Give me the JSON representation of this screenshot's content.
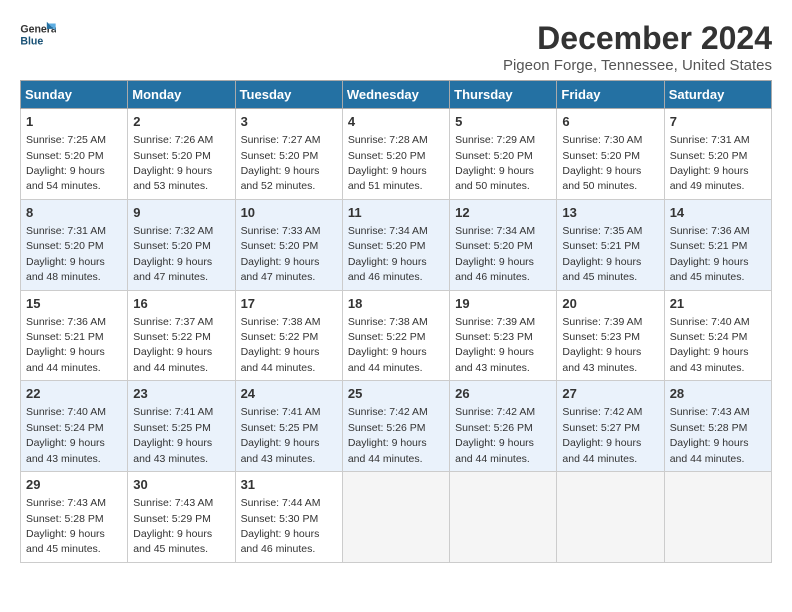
{
  "header": {
    "logo_general": "General",
    "logo_blue": "Blue",
    "month_title": "December 2024",
    "location": "Pigeon Forge, Tennessee, United States"
  },
  "weekdays": [
    "Sunday",
    "Monday",
    "Tuesday",
    "Wednesday",
    "Thursday",
    "Friday",
    "Saturday"
  ],
  "weeks": [
    [
      {
        "day": "1",
        "sunrise": "7:25 AM",
        "sunset": "5:20 PM",
        "daylight": "9 hours and 54 minutes."
      },
      {
        "day": "2",
        "sunrise": "7:26 AM",
        "sunset": "5:20 PM",
        "daylight": "9 hours and 53 minutes."
      },
      {
        "day": "3",
        "sunrise": "7:27 AM",
        "sunset": "5:20 PM",
        "daylight": "9 hours and 52 minutes."
      },
      {
        "day": "4",
        "sunrise": "7:28 AM",
        "sunset": "5:20 PM",
        "daylight": "9 hours and 51 minutes."
      },
      {
        "day": "5",
        "sunrise": "7:29 AM",
        "sunset": "5:20 PM",
        "daylight": "9 hours and 50 minutes."
      },
      {
        "day": "6",
        "sunrise": "7:30 AM",
        "sunset": "5:20 PM",
        "daylight": "9 hours and 50 minutes."
      },
      {
        "day": "7",
        "sunrise": "7:31 AM",
        "sunset": "5:20 PM",
        "daylight": "9 hours and 49 minutes."
      }
    ],
    [
      {
        "day": "8",
        "sunrise": "7:31 AM",
        "sunset": "5:20 PM",
        "daylight": "9 hours and 48 minutes."
      },
      {
        "day": "9",
        "sunrise": "7:32 AM",
        "sunset": "5:20 PM",
        "daylight": "9 hours and 47 minutes."
      },
      {
        "day": "10",
        "sunrise": "7:33 AM",
        "sunset": "5:20 PM",
        "daylight": "9 hours and 47 minutes."
      },
      {
        "day": "11",
        "sunrise": "7:34 AM",
        "sunset": "5:20 PM",
        "daylight": "9 hours and 46 minutes."
      },
      {
        "day": "12",
        "sunrise": "7:34 AM",
        "sunset": "5:20 PM",
        "daylight": "9 hours and 46 minutes."
      },
      {
        "day": "13",
        "sunrise": "7:35 AM",
        "sunset": "5:21 PM",
        "daylight": "9 hours and 45 minutes."
      },
      {
        "day": "14",
        "sunrise": "7:36 AM",
        "sunset": "5:21 PM",
        "daylight": "9 hours and 45 minutes."
      }
    ],
    [
      {
        "day": "15",
        "sunrise": "7:36 AM",
        "sunset": "5:21 PM",
        "daylight": "9 hours and 44 minutes."
      },
      {
        "day": "16",
        "sunrise": "7:37 AM",
        "sunset": "5:22 PM",
        "daylight": "9 hours and 44 minutes."
      },
      {
        "day": "17",
        "sunrise": "7:38 AM",
        "sunset": "5:22 PM",
        "daylight": "9 hours and 44 minutes."
      },
      {
        "day": "18",
        "sunrise": "7:38 AM",
        "sunset": "5:22 PM",
        "daylight": "9 hours and 44 minutes."
      },
      {
        "day": "19",
        "sunrise": "7:39 AM",
        "sunset": "5:23 PM",
        "daylight": "9 hours and 43 minutes."
      },
      {
        "day": "20",
        "sunrise": "7:39 AM",
        "sunset": "5:23 PM",
        "daylight": "9 hours and 43 minutes."
      },
      {
        "day": "21",
        "sunrise": "7:40 AM",
        "sunset": "5:24 PM",
        "daylight": "9 hours and 43 minutes."
      }
    ],
    [
      {
        "day": "22",
        "sunrise": "7:40 AM",
        "sunset": "5:24 PM",
        "daylight": "9 hours and 43 minutes."
      },
      {
        "day": "23",
        "sunrise": "7:41 AM",
        "sunset": "5:25 PM",
        "daylight": "9 hours and 43 minutes."
      },
      {
        "day": "24",
        "sunrise": "7:41 AM",
        "sunset": "5:25 PM",
        "daylight": "9 hours and 43 minutes."
      },
      {
        "day": "25",
        "sunrise": "7:42 AM",
        "sunset": "5:26 PM",
        "daylight": "9 hours and 44 minutes."
      },
      {
        "day": "26",
        "sunrise": "7:42 AM",
        "sunset": "5:26 PM",
        "daylight": "9 hours and 44 minutes."
      },
      {
        "day": "27",
        "sunrise": "7:42 AM",
        "sunset": "5:27 PM",
        "daylight": "9 hours and 44 minutes."
      },
      {
        "day": "28",
        "sunrise": "7:43 AM",
        "sunset": "5:28 PM",
        "daylight": "9 hours and 44 minutes."
      }
    ],
    [
      {
        "day": "29",
        "sunrise": "7:43 AM",
        "sunset": "5:28 PM",
        "daylight": "9 hours and 45 minutes."
      },
      {
        "day": "30",
        "sunrise": "7:43 AM",
        "sunset": "5:29 PM",
        "daylight": "9 hours and 45 minutes."
      },
      {
        "day": "31",
        "sunrise": "7:44 AM",
        "sunset": "5:30 PM",
        "daylight": "9 hours and 46 minutes."
      },
      null,
      null,
      null,
      null
    ]
  ]
}
